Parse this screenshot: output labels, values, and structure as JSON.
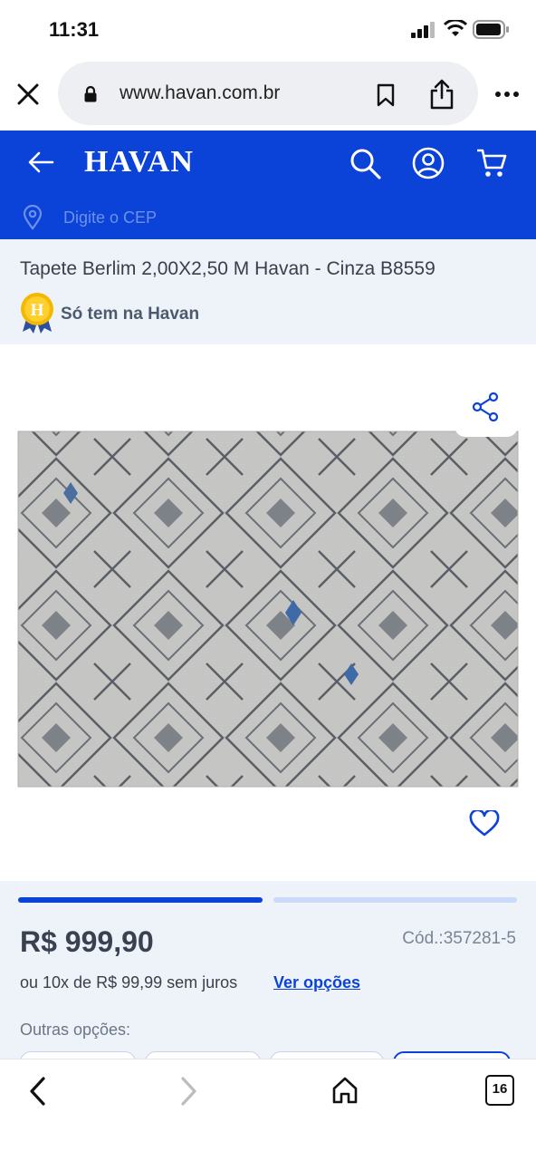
{
  "status_bar": {
    "time": "11:31"
  },
  "browser": {
    "url": "www.havan.com.br",
    "tabs_count": "16"
  },
  "header": {
    "logo": "HAVAN",
    "cep_placeholder": "Digite o CEP"
  },
  "product": {
    "title": "Tapete Berlim 2,00X2,50 M Havan - Cinza B8559",
    "badge_letter": "H",
    "exclusive_label": "Só tem na Havan",
    "price": "R$ 999,90",
    "code": "Cód.:357281-5",
    "installments": "ou 10x de R$ 99,99 sem juros",
    "see_options": "Ver opções",
    "other_options_label": "Outras opções:",
    "gallery_progress": 0.5
  },
  "colors": {
    "brand": "#0b43d8",
    "panel": "#eef3fa"
  }
}
